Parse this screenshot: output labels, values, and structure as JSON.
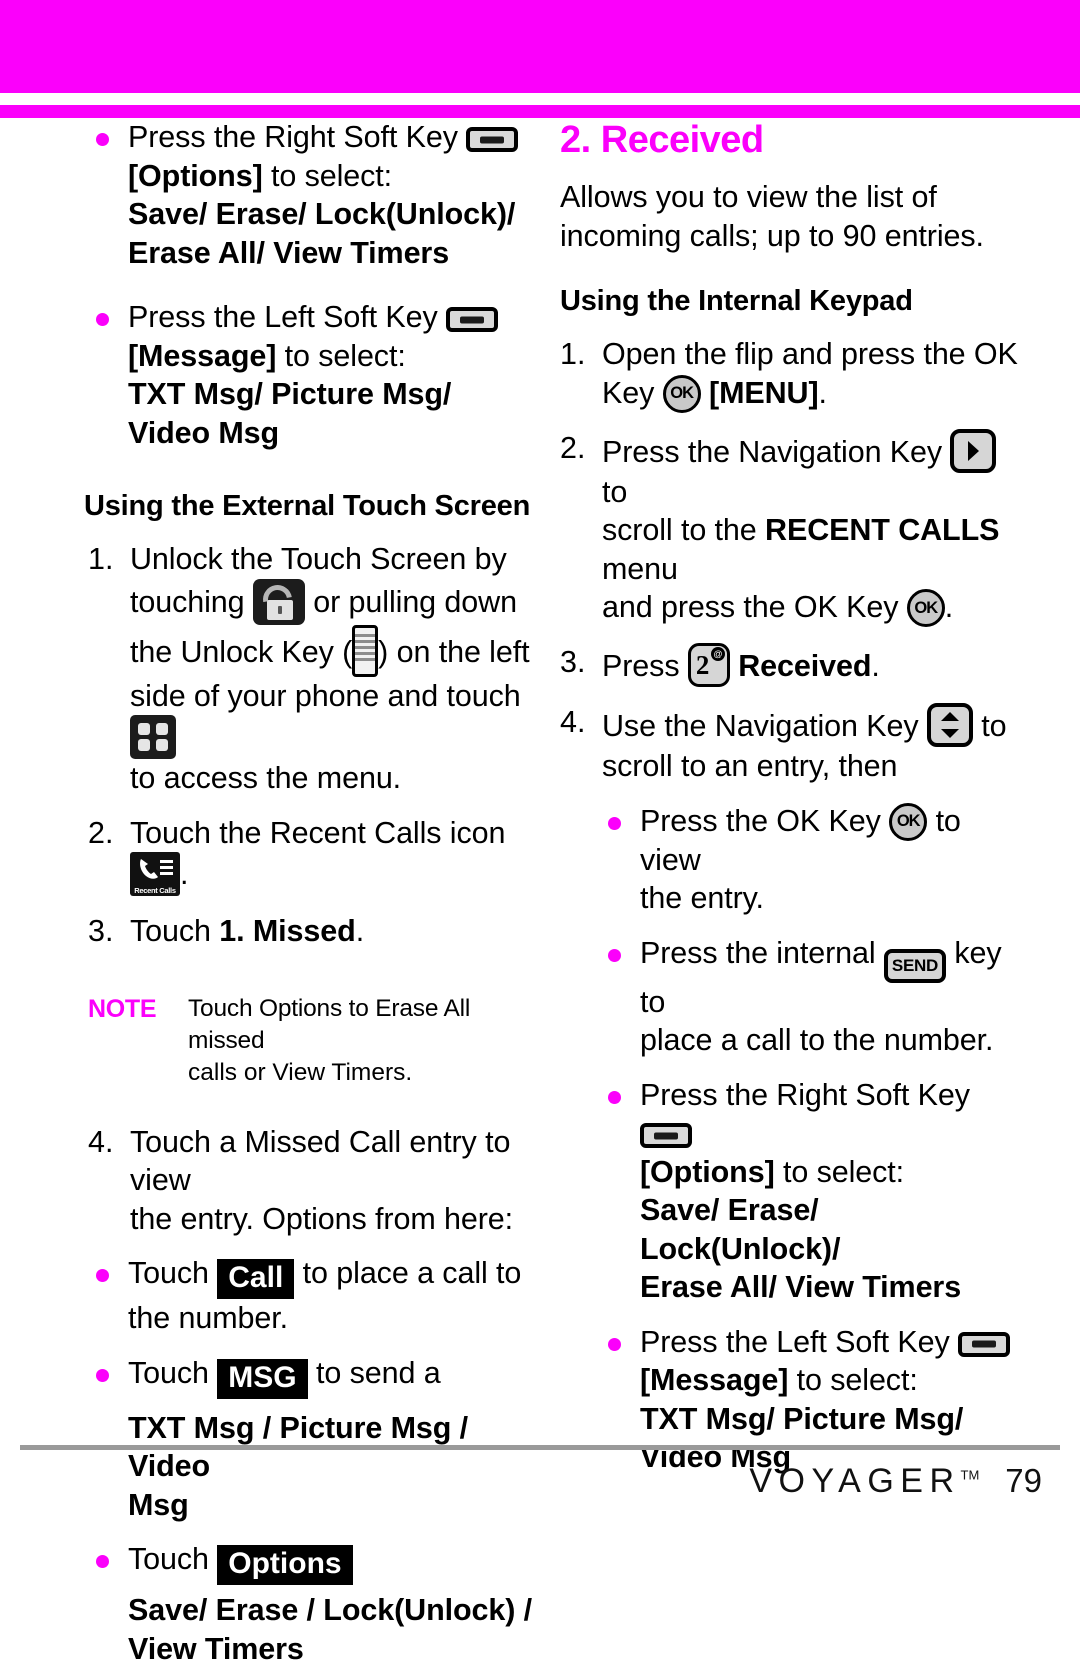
{
  "theme": {
    "accent": "#fb00fb",
    "text": "#000000",
    "chip_bg": "#000000",
    "key_fill": "#d6d6d6"
  },
  "banner": {
    "color": "#fb00fb"
  },
  "left_column": {
    "b1_line1": "Press the Right Soft Key",
    "b1_line2_bold": "[Options]",
    "b1_line2_rest": " to select:",
    "b1_line3": "Save/ Erase/ Lock(Unlock)/",
    "b1_line4": "Erase All/ View Timers",
    "b2_line1": "Press the Left Soft Key",
    "b2_line2_bold": "[Message]",
    "b2_line2_rest": " to select:",
    "b2_line3": "TXT Msg/ Picture Msg/",
    "b2_line4": "Video Msg",
    "heading": "Using the External Touch Screen",
    "s1_num": "1.",
    "s1_a": "Unlock the Touch Screen by",
    "s1_b": "touching",
    "s1_c": "or pulling down",
    "s1_d": "the Unlock Key (",
    "s1_e": ") on the left",
    "s1_f": "side of your phone and touch",
    "s1_g": "to access the menu.",
    "s2_num": "2.",
    "s2_a": "Touch the Recent Calls icon",
    "s2_b": ".",
    "s3_num": "3.",
    "s3_a": "Touch ",
    "s3_bold": "1. Missed",
    "s3_b": ".",
    "note_tag": "NOTE",
    "note_line1": "Touch Options to Erase All missed",
    "note_line2": "calls or View Timers.",
    "s4_num": "4.",
    "s4_a": "Touch a Missed Call entry to view",
    "s4_b": "the entry. Options from here:",
    "b3_pre": "Touch",
    "b3_chip": "Call",
    "b3_post": "to place a call to",
    "b3_line2": "the number.",
    "b4_pre": "Touch",
    "b4_chip": "MSG",
    "b4_post": "to send a",
    "b4_line2": "TXT Msg / Picture Msg / Video",
    "b4_line3": "Msg",
    "b5_pre": "Touch",
    "b5_chip": "Options",
    "b5_line2": "Save/ Erase / Lock(Unlock) /",
    "b5_line3": "View Timers"
  },
  "right_column": {
    "title": "2. Received",
    "intro_line1": "Allows you to view the list of",
    "intro_line2": "incoming calls; up to 90 entries.",
    "heading": "Using the Internal Keypad",
    "s1_num": "1.",
    "s1_a": "Open the flip and press the OK",
    "s1_b": "Key",
    "s1_c_bold": "[MENU]",
    "s1_c_rest": ".",
    "s2_num": "2.",
    "s2_a": "Press the Navigation Key",
    "s2_b": "to",
    "s2_c": "scroll to the ",
    "s2_c_bold": "RECENT CALLS",
    "s2_c_rest": " menu",
    "s2_d": "and press the OK Key",
    "s2_e": ".",
    "s3_num": "3.",
    "s3_a": "Press",
    "s3_bold": "Received",
    "s3_b": ".",
    "s4_num": "4.",
    "s4_a": "Use the Navigation Key",
    "s4_b": "to",
    "s4_c": "scroll to an entry, then",
    "b1_pre": "Press the OK Key",
    "b1_post": "to view",
    "b1_line2": "the entry.",
    "b2_pre": "Press the internal",
    "b2_key": "SEND",
    "b2_post": "key to",
    "b2_line2": "place a call to the number.",
    "b3_line1": "Press the Right Soft Key",
    "b3_line2_bold": "[Options]",
    "b3_line2_rest": " to select:",
    "b3_line3": "Save/ Erase/ Lock(Unlock)/",
    "b3_line4": "Erase All/ View Timers",
    "b4_line1": "Press the Left Soft Key",
    "b4_line2_bold": "[Message]",
    "b4_line2_rest": " to select:",
    "b4_line3": "TXT Msg/ Picture Msg/",
    "b4_line4": "Video Msg"
  },
  "icons": {
    "soft_key": "soft-key-icon",
    "ok_key_label": "OK",
    "nav_right": "nav-right-icon",
    "nav_updown": "nav-updown-icon",
    "key_2_digit": "2",
    "key_2_badge": "@",
    "send_key_label": "SEND",
    "padlock": "padlock-icon",
    "unlock_key": "unlock-key-icon",
    "menu_grid": "menu-grid-icon",
    "recent_calls_label": "Recent Calls"
  },
  "footer": {
    "brand": "VOYAGER",
    "tm": "TM",
    "page_number": "79"
  }
}
